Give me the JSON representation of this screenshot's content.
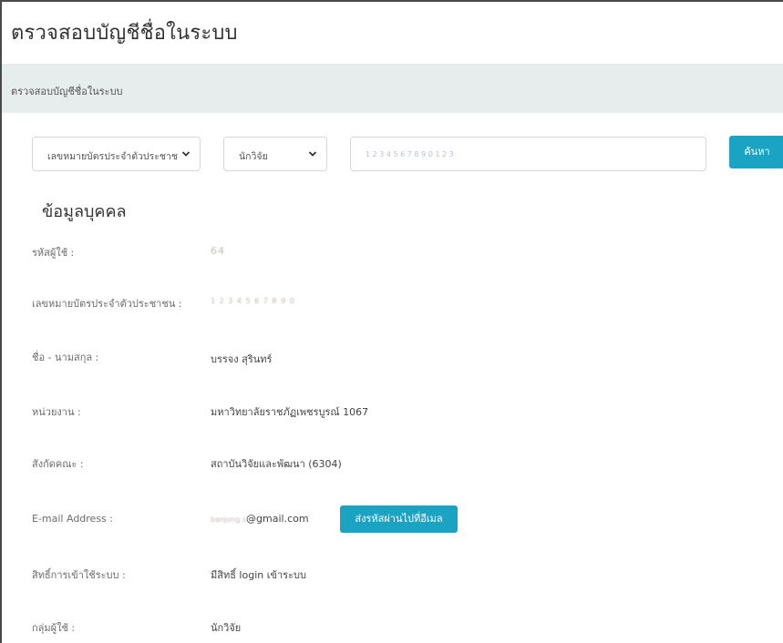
{
  "page": {
    "title": "ตรวจสอบบัญชีชื่อในระบบ",
    "breadcrumb": "ตรวจสอบบัญชีชื่อในระบบ"
  },
  "search": {
    "id_type_select": "เลขหมายบัตรประจำตัวประชาช",
    "role_select": "นักวิจัย",
    "input_value": "1 2 3 4 5 6 7 8 9 0 1 2 3",
    "button_label": "ค้นหา"
  },
  "profile": {
    "section_title": "ข้อมูลบุคคล",
    "rows": [
      {
        "label": "รหัสผู้ใช้ :",
        "value": "64"
      },
      {
        "label": "เลขหมายบัตรประจำตัวประชาชน :",
        "value": "1 2 3 4 5 6 7 8 9 0"
      },
      {
        "label": "ชื่อ - นามสกุล :",
        "value": "บรรจง สุรินทร์"
      },
      {
        "label": "หน่วยงาน :",
        "value": "มหาวิทยาลัยราชภัฏเพชรบูรณ์ 1067"
      },
      {
        "label": "สังกัดคณะ :",
        "value": "สถาบันวิจัยและพัฒนา (6304)"
      },
      {
        "label": "E-mail Address :",
        "value": "@gmail.com",
        "email_prefix": "banjong.s"
      },
      {
        "label": "สิทธิ์การเข้าใช้ระบบ :",
        "value": "มีสิทธิ์ login เข้าระบบ"
      },
      {
        "label": "กลุ่มผู้ใช้ :",
        "value": "นักวิจัย"
      }
    ],
    "send_password_button": "ส่งรหัสผ่านไปที่อีเมล"
  },
  "icons": {
    "select_chevron": "chevron-down-icon"
  },
  "colors": {
    "accent": "#1aa3c3",
    "breadcrumb_bg": "#e7ecec"
  }
}
